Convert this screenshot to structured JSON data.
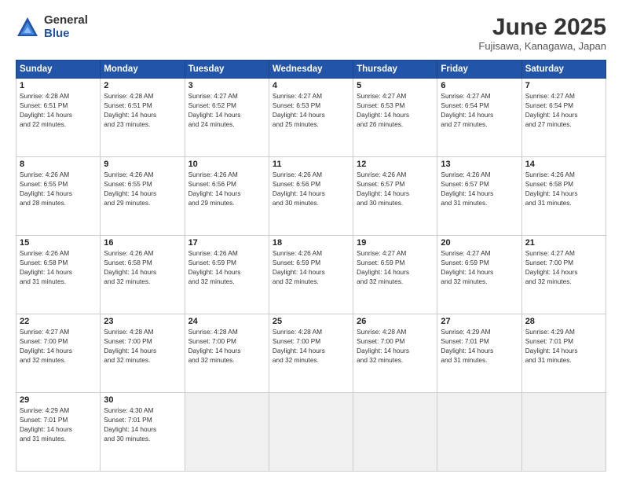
{
  "logo": {
    "general": "General",
    "blue": "Blue"
  },
  "header": {
    "month": "June 2025",
    "location": "Fujisawa, Kanagawa, Japan"
  },
  "weekdays": [
    "Sunday",
    "Monday",
    "Tuesday",
    "Wednesday",
    "Thursday",
    "Friday",
    "Saturday"
  ],
  "weeks": [
    [
      {
        "day": "1",
        "info": "Sunrise: 4:28 AM\nSunset: 6:51 PM\nDaylight: 14 hours\nand 22 minutes."
      },
      {
        "day": "2",
        "info": "Sunrise: 4:28 AM\nSunset: 6:51 PM\nDaylight: 14 hours\nand 23 minutes."
      },
      {
        "day": "3",
        "info": "Sunrise: 4:27 AM\nSunset: 6:52 PM\nDaylight: 14 hours\nand 24 minutes."
      },
      {
        "day": "4",
        "info": "Sunrise: 4:27 AM\nSunset: 6:53 PM\nDaylight: 14 hours\nand 25 minutes."
      },
      {
        "day": "5",
        "info": "Sunrise: 4:27 AM\nSunset: 6:53 PM\nDaylight: 14 hours\nand 26 minutes."
      },
      {
        "day": "6",
        "info": "Sunrise: 4:27 AM\nSunset: 6:54 PM\nDaylight: 14 hours\nand 27 minutes."
      },
      {
        "day": "7",
        "info": "Sunrise: 4:27 AM\nSunset: 6:54 PM\nDaylight: 14 hours\nand 27 minutes."
      }
    ],
    [
      {
        "day": "8",
        "info": "Sunrise: 4:26 AM\nSunset: 6:55 PM\nDaylight: 14 hours\nand 28 minutes."
      },
      {
        "day": "9",
        "info": "Sunrise: 4:26 AM\nSunset: 6:55 PM\nDaylight: 14 hours\nand 29 minutes."
      },
      {
        "day": "10",
        "info": "Sunrise: 4:26 AM\nSunset: 6:56 PM\nDaylight: 14 hours\nand 29 minutes."
      },
      {
        "day": "11",
        "info": "Sunrise: 4:26 AM\nSunset: 6:56 PM\nDaylight: 14 hours\nand 30 minutes."
      },
      {
        "day": "12",
        "info": "Sunrise: 4:26 AM\nSunset: 6:57 PM\nDaylight: 14 hours\nand 30 minutes."
      },
      {
        "day": "13",
        "info": "Sunrise: 4:26 AM\nSunset: 6:57 PM\nDaylight: 14 hours\nand 31 minutes."
      },
      {
        "day": "14",
        "info": "Sunrise: 4:26 AM\nSunset: 6:58 PM\nDaylight: 14 hours\nand 31 minutes."
      }
    ],
    [
      {
        "day": "15",
        "info": "Sunrise: 4:26 AM\nSunset: 6:58 PM\nDaylight: 14 hours\nand 31 minutes."
      },
      {
        "day": "16",
        "info": "Sunrise: 4:26 AM\nSunset: 6:58 PM\nDaylight: 14 hours\nand 32 minutes."
      },
      {
        "day": "17",
        "info": "Sunrise: 4:26 AM\nSunset: 6:59 PM\nDaylight: 14 hours\nand 32 minutes."
      },
      {
        "day": "18",
        "info": "Sunrise: 4:26 AM\nSunset: 6:59 PM\nDaylight: 14 hours\nand 32 minutes."
      },
      {
        "day": "19",
        "info": "Sunrise: 4:27 AM\nSunset: 6:59 PM\nDaylight: 14 hours\nand 32 minutes."
      },
      {
        "day": "20",
        "info": "Sunrise: 4:27 AM\nSunset: 6:59 PM\nDaylight: 14 hours\nand 32 minutes."
      },
      {
        "day": "21",
        "info": "Sunrise: 4:27 AM\nSunset: 7:00 PM\nDaylight: 14 hours\nand 32 minutes."
      }
    ],
    [
      {
        "day": "22",
        "info": "Sunrise: 4:27 AM\nSunset: 7:00 PM\nDaylight: 14 hours\nand 32 minutes."
      },
      {
        "day": "23",
        "info": "Sunrise: 4:28 AM\nSunset: 7:00 PM\nDaylight: 14 hours\nand 32 minutes."
      },
      {
        "day": "24",
        "info": "Sunrise: 4:28 AM\nSunset: 7:00 PM\nDaylight: 14 hours\nand 32 minutes."
      },
      {
        "day": "25",
        "info": "Sunrise: 4:28 AM\nSunset: 7:00 PM\nDaylight: 14 hours\nand 32 minutes."
      },
      {
        "day": "26",
        "info": "Sunrise: 4:28 AM\nSunset: 7:00 PM\nDaylight: 14 hours\nand 32 minutes."
      },
      {
        "day": "27",
        "info": "Sunrise: 4:29 AM\nSunset: 7:01 PM\nDaylight: 14 hours\nand 31 minutes."
      },
      {
        "day": "28",
        "info": "Sunrise: 4:29 AM\nSunset: 7:01 PM\nDaylight: 14 hours\nand 31 minutes."
      }
    ],
    [
      {
        "day": "29",
        "info": "Sunrise: 4:29 AM\nSunset: 7:01 PM\nDaylight: 14 hours\nand 31 minutes."
      },
      {
        "day": "30",
        "info": "Sunrise: 4:30 AM\nSunset: 7:01 PM\nDaylight: 14 hours\nand 30 minutes."
      },
      {
        "day": "",
        "info": ""
      },
      {
        "day": "",
        "info": ""
      },
      {
        "day": "",
        "info": ""
      },
      {
        "day": "",
        "info": ""
      },
      {
        "day": "",
        "info": ""
      }
    ]
  ]
}
